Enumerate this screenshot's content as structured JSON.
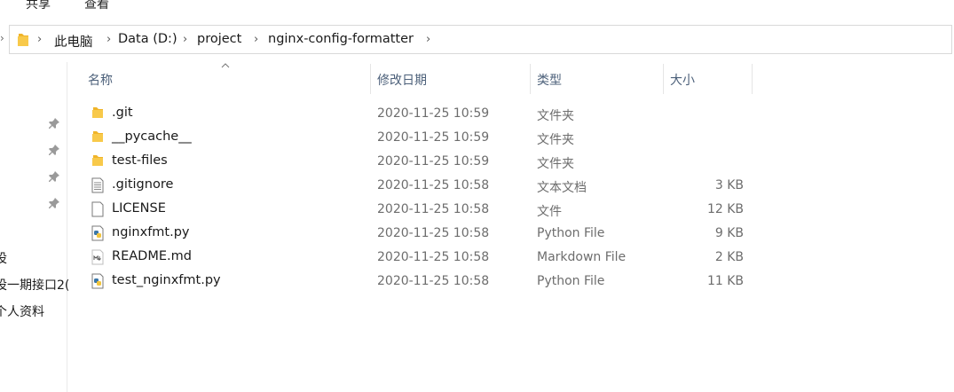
{
  "ribbon": {
    "tabs": [
      "共享",
      "查看"
    ]
  },
  "address_bar": {
    "crumbs": [
      "此电脑",
      "Data (D:)",
      "project",
      "nginx-config-formatter"
    ]
  },
  "nav_pane": {
    "items": [
      "设",
      "设一期接口2(",
      "个人资料"
    ]
  },
  "columns": {
    "name": "名称",
    "date": "修改日期",
    "type": "类型",
    "size": "大小"
  },
  "files": [
    {
      "name": ".git",
      "date": "2020-11-25 10:59",
      "type": "文件夹",
      "size": "",
      "icon": "folder-icon"
    },
    {
      "name": "__pycache__",
      "date": "2020-11-25 10:59",
      "type": "文件夹",
      "size": "",
      "icon": "folder-icon"
    },
    {
      "name": "test-files",
      "date": "2020-11-25 10:59",
      "type": "文件夹",
      "size": "",
      "icon": "folder-icon"
    },
    {
      "name": ".gitignore",
      "date": "2020-11-25 10:58",
      "type": "文本文档",
      "size": "3 KB",
      "icon": "text-document-icon"
    },
    {
      "name": "LICENSE",
      "date": "2020-11-25 10:58",
      "type": "文件",
      "size": "12 KB",
      "icon": "blank-file-icon"
    },
    {
      "name": "nginxfmt.py",
      "date": "2020-11-25 10:58",
      "type": "Python File",
      "size": "9 KB",
      "icon": "python-file-icon"
    },
    {
      "name": "README.md",
      "date": "2020-11-25 10:58",
      "type": "Markdown File",
      "size": "2 KB",
      "icon": "markdown-file-icon"
    },
    {
      "name": "test_nginxfmt.py",
      "date": "2020-11-25 10:58",
      "type": "Python File",
      "size": "11 KB",
      "icon": "python-file-icon"
    }
  ],
  "colors": {
    "folder": "#f8c94a",
    "header_text": "#4c607a",
    "muted_text": "#6d6d6d"
  }
}
